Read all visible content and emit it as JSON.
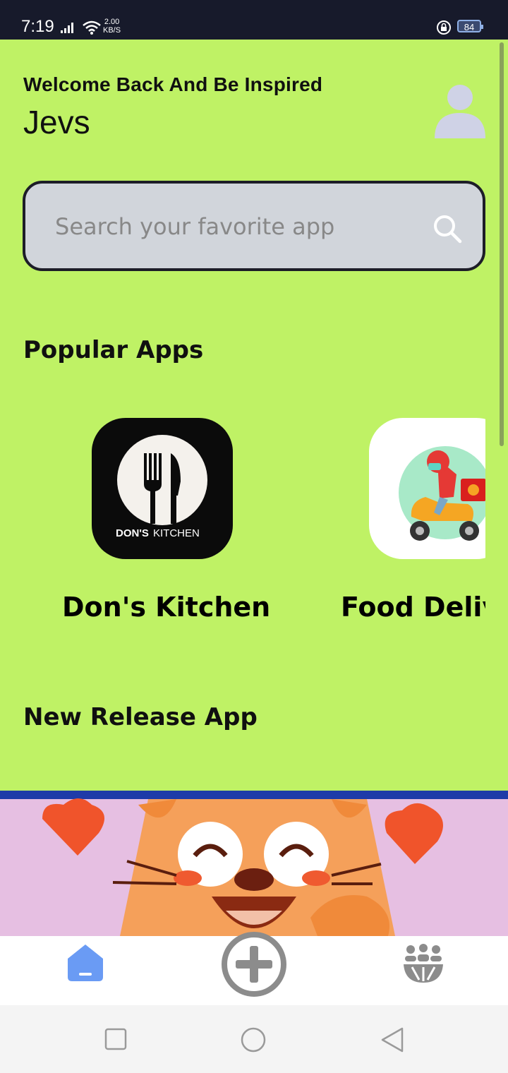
{
  "status": {
    "time": "7:19",
    "net_speed_value": "2.00",
    "net_speed_unit": "KB/S",
    "battery": "84"
  },
  "header": {
    "welcome": "Welcome Back And Be Inspired",
    "username": "Jevs"
  },
  "search": {
    "placeholder": "Search your favorite app"
  },
  "sections": {
    "popular": "Popular Apps",
    "new_release": "New Release App"
  },
  "popular_apps": [
    {
      "name": "Don's Kitchen",
      "logo_text_bold": "DON'S",
      "logo_text_light": "KITCHEN",
      "icon": "fork-knife-logo"
    },
    {
      "name": "Food Deliv",
      "icon": "delivery-scooter-logo"
    }
  ],
  "nav": {
    "items": [
      "home-icon",
      "add-icon",
      "community-icon"
    ],
    "active_color": "#6a9bf4"
  },
  "colors": {
    "background": "#bff265",
    "status_bar": "#171a2b",
    "search_bg": "#d1d5db"
  }
}
